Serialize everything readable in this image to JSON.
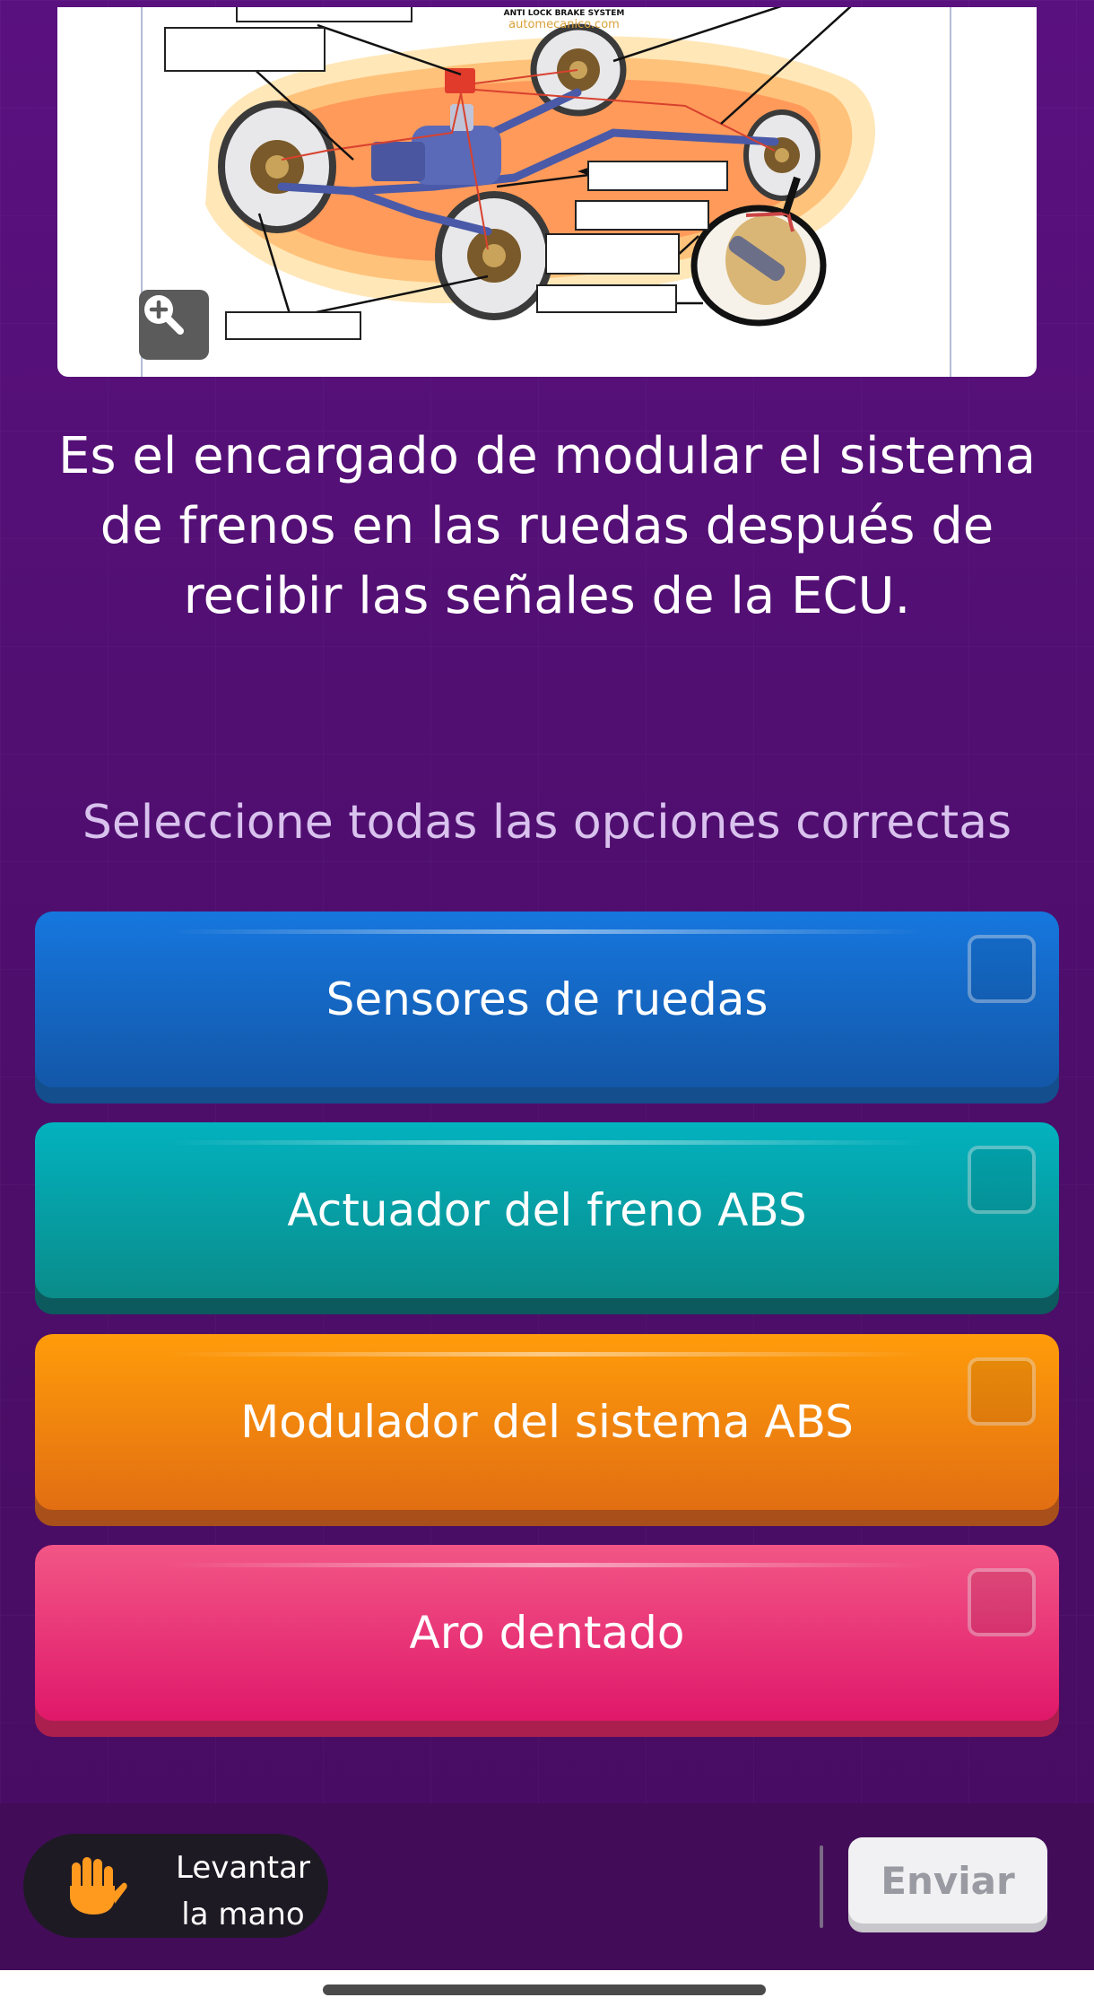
{
  "diagram": {
    "title": "ANTI LOCK BRAKE SYSTEM",
    "watermark": "automecanico.com"
  },
  "zoom_icon": "zoom-in-icon",
  "question": "Es el encargado de modular el sistema de frenos en las ruedas después de recibir las señales de la ECU.",
  "instruction": "Seleccione todas las opciones correctas",
  "options": [
    {
      "label": "Sensores de ruedas",
      "color": "#1677de",
      "checked": false
    },
    {
      "label": "Actuador del freno ABS",
      "color": "#02b2bf",
      "checked": false
    },
    {
      "label": "Modulador del sistema ABS",
      "color": "#ff9c0a",
      "checked": false
    },
    {
      "label": "Aro dentado",
      "color": "#f25686",
      "checked": false
    }
  ],
  "footer": {
    "raise_hand_line1": "Levantar",
    "raise_hand_line2": "la mano",
    "raise_hand_icon": "hand-icon",
    "submit_label": "Enviar"
  },
  "colors": {
    "background": "#4e0f6b",
    "submit_disabled": "#f1f1f3",
    "hand": "#ff9a1f"
  }
}
